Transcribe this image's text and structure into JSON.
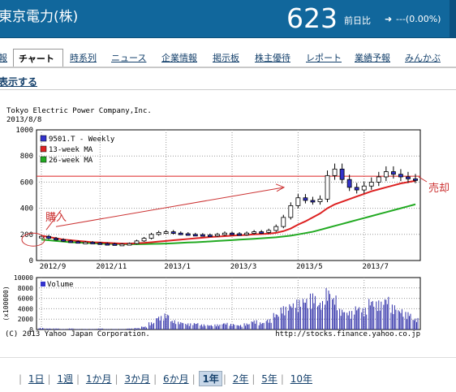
{
  "header": {
    "company": "東京電力(株)",
    "price": "623",
    "change_label": "前日比",
    "change_arrow": "➜",
    "change_value": "---(0.00%)"
  },
  "tabs": [
    {
      "label": "報"
    },
    {
      "label": "チャート"
    },
    {
      "label": "時系列"
    },
    {
      "label": "ニュース"
    },
    {
      "label": "企業情報"
    },
    {
      "label": "掲示板"
    },
    {
      "label": "株主優待"
    },
    {
      "label": "レポート"
    },
    {
      "label": "業績予報"
    },
    {
      "label": "みんかぶ"
    }
  ],
  "show_link": "表示する",
  "chart": {
    "company_name": "Tokyo Electric Power Company,Inc.",
    "date": "2013/8/8",
    "legend": [
      "9501.T - Weekly",
      "13-week MA",
      "26-week MA"
    ],
    "y_ticks": [
      "1000",
      "800",
      "600",
      "400",
      "200",
      "0"
    ],
    "x_ticks": [
      "2012/9",
      "2012/11",
      "2013/1",
      "2013/3",
      "2013/5",
      "2013/7"
    ],
    "annotation_buy": "購入",
    "annotation_sell": "売却",
    "volume_legend": "Volume",
    "volume_ylabel": "(x100000)",
    "volume_ticks": [
      "10000",
      "8000",
      "6000",
      "4000",
      "2000",
      "0"
    ],
    "copyright": "(C) 2013 Yahoo Japan Corporation.",
    "url": "http://stocks.finance.yahoo.co.jp",
    "colors": {
      "price": "#3333cc",
      "ma13": "#dd2222",
      "ma26": "#22aa22",
      "annot": "#cc3333"
    }
  },
  "chart_data": {
    "type": "line",
    "title": "Tokyo Electric Power Company,Inc.",
    "xlabel": "",
    "ylabel": "",
    "ylim": [
      0,
      1000
    ],
    "x": [
      "2012/9",
      "",
      "",
      "",
      "",
      "",
      "",
      "",
      "2012/11",
      "",
      "",
      "",
      "",
      "",
      "",
      "",
      "",
      "2013/1",
      "",
      "",
      "",
      "",
      "",
      "",
      "",
      "",
      "2013/3",
      "",
      "",
      "",
      "",
      "",
      "",
      "",
      "",
      "2013/5",
      "",
      "",
      "",
      "",
      "",
      "",
      "",
      "",
      "2013/7",
      "",
      "",
      "",
      "",
      "",
      ""
    ],
    "series": [
      {
        "name": "9501.T - Weekly",
        "values": [
          185,
          170,
          160,
          150,
          145,
          140,
          140,
          135,
          130,
          128,
          125,
          125,
          130,
          150,
          170,
          200,
          215,
          220,
          210,
          205,
          200,
          198,
          195,
          190,
          200,
          210,
          205,
          200,
          210,
          220,
          215,
          230,
          260,
          330,
          420,
          480,
          460,
          450,
          470,
          650,
          700,
          620,
          560,
          540,
          570,
          600,
          640,
          680,
          660,
          640,
          625,
          623
        ]
      },
      {
        "name": "13-week MA",
        "values": [
          190,
          180,
          170,
          160,
          155,
          150,
          145,
          140,
          138,
          135,
          132,
          130,
          130,
          132,
          135,
          140,
          145,
          150,
          155,
          160,
          165,
          170,
          175,
          180,
          183,
          186,
          190,
          193,
          196,
          200,
          203,
          206,
          212,
          225,
          245,
          275,
          300,
          330,
          360,
          400,
          430,
          450,
          470,
          490,
          510,
          530,
          545,
          560,
          575,
          590,
          600,
          610
        ]
      },
      {
        "name": "26-week MA",
        "values": [
          160,
          155,
          150,
          145,
          140,
          138,
          135,
          133,
          130,
          128,
          127,
          126,
          125,
          125,
          126,
          127,
          128,
          130,
          132,
          135,
          138,
          140,
          143,
          146,
          150,
          153,
          156,
          160,
          163,
          166,
          170,
          174,
          178,
          184,
          190,
          200,
          210,
          220,
          235,
          250,
          265,
          280,
          295,
          310,
          325,
          340,
          355,
          370,
          385,
          400,
          415,
          430
        ]
      }
    ],
    "volume": [
      0.3,
      0.2,
      0.2,
      0.1,
      0.2,
      0.1,
      0.1,
      0.1,
      0.2,
      0.1,
      0.1,
      0.1,
      0.2,
      0.3,
      0.6,
      1.4,
      2.6,
      3.1,
      1.8,
      1.5,
      1.2,
      1.3,
      1.0,
      0.9,
      1.0,
      1.3,
      1.1,
      0.9,
      1.2,
      1.8,
      1.4,
      2.0,
      3.2,
      4.5,
      5.2,
      5.8,
      6.2,
      7.0,
      5.5,
      8.0,
      6.6,
      4.0,
      3.6,
      4.6,
      4.2,
      6.0,
      5.6,
      6.4,
      4.8,
      4.0,
      3.4,
      2.2
    ]
  }
}
